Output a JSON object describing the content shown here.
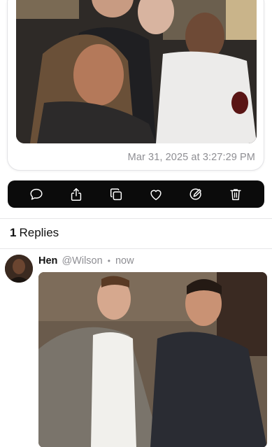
{
  "post": {
    "timestamp": "Mar 31, 2025 at 3:27:29 PM"
  },
  "toolbar": {
    "actions": [
      {
        "icon": "comment-icon"
      },
      {
        "icon": "share-icon"
      },
      {
        "icon": "copy-icon"
      },
      {
        "icon": "heart-icon"
      },
      {
        "icon": "edit-icon"
      },
      {
        "icon": "trash-icon"
      }
    ]
  },
  "replies": {
    "count": "1",
    "label": "Replies"
  },
  "reply": {
    "name": "Hen",
    "handle": "@Wilson",
    "separator": "•",
    "time": "now"
  },
  "colors": {
    "toolbar_bg": "#0b0b0b",
    "meta_gray": "#8e8e93"
  }
}
